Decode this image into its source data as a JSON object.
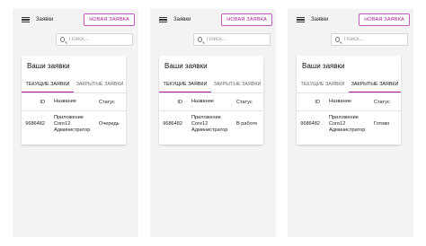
{
  "app": {
    "title": "Заявки",
    "new_button": "НОВАЯ ЗАЯВКА",
    "search_placeholder": "Поиск...",
    "card_title": "Ваши заявки"
  },
  "tabs": {
    "current": "ТЕКУЩИЕ ЗАЯВКИ",
    "closed": "ЗАКРЫТЫЕ ЗАЯВКИ"
  },
  "columns": {
    "id": "ID",
    "name": "Название",
    "status": "Статус"
  },
  "screens": [
    {
      "active_tab": "current",
      "row": {
        "id": "9686482",
        "name_lines": [
          "Приложение",
          "Core12",
          "Администратор"
        ],
        "status": "Очередь"
      }
    },
    {
      "active_tab": "current",
      "row": {
        "id": "9686482",
        "name_lines": [
          "Приложение",
          "Core12",
          "Администратор"
        ],
        "status": "В работе"
      }
    },
    {
      "active_tab": "closed",
      "row": {
        "id": "9686482",
        "name_lines": [
          "Приложение",
          "Core12",
          "Администратор"
        ],
        "status": "Готово"
      }
    }
  ],
  "colors": {
    "accent": "#b0199c",
    "background": "#f3f3f3"
  },
  "icons": {
    "menu": "hamburger-menu-icon",
    "search": "search-icon"
  }
}
